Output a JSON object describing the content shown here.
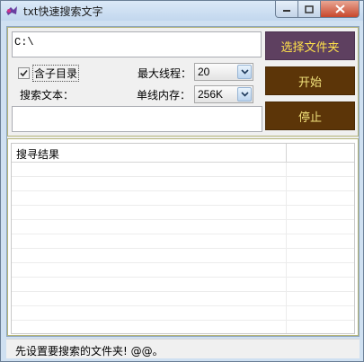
{
  "window": {
    "title": "txt快速搜索文字"
  },
  "folder": {
    "path": "C:\\"
  },
  "options": {
    "include_subdirs_label": "含子目录",
    "include_subdirs_checked": true,
    "max_threads_label": "最大线程：",
    "max_threads_value": "20",
    "search_text_label": "搜索文本：",
    "memory_label": "单线内存：",
    "memory_value": "256K",
    "search_text_value": ""
  },
  "buttons": {
    "select_folder": "选择文件夹",
    "start": "开始",
    "stop": "停止"
  },
  "colors": {
    "select_button_bg": "#5e4060",
    "select_button_text": "#ffe14a",
    "action_button_bg": "#5c3508",
    "action_button_text": "#f2e27b"
  },
  "results": {
    "column_header": "搜寻结果",
    "rows": []
  },
  "status": {
    "text": "先设置要搜索的文件夹! @@。"
  }
}
